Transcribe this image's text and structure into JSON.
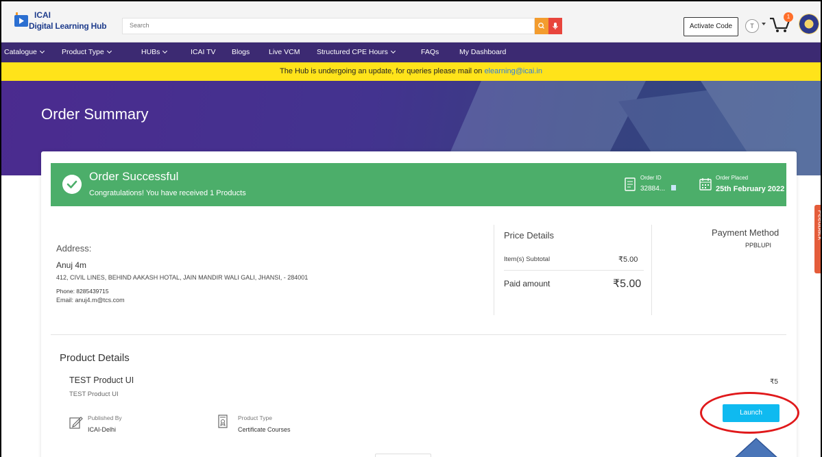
{
  "header": {
    "logo_line1": "ICAI",
    "logo_line2": "Digital Learning Hub",
    "search_placeholder": "Search",
    "activate_label": "Activate Code",
    "avatar_initial": "T",
    "cart_count": "1"
  },
  "nav": {
    "items": [
      {
        "label": "Catalogue",
        "dropdown": true
      },
      {
        "label": "Product Type",
        "dropdown": true
      },
      {
        "label": "HUBs",
        "dropdown": true
      },
      {
        "label": "ICAI TV",
        "dropdown": false
      },
      {
        "label": "Blogs",
        "dropdown": false
      },
      {
        "label": "Live VCM",
        "dropdown": false
      },
      {
        "label": "Structured CPE Hours",
        "dropdown": true
      },
      {
        "label": "FAQs",
        "dropdown": false
      },
      {
        "label": "My Dashboard",
        "dropdown": false
      }
    ]
  },
  "notice": {
    "text": "The Hub is undergoing an update, for queries please mail on ",
    "email": "elearning@icai.in"
  },
  "page": {
    "title": "Order Summary"
  },
  "order": {
    "status_title": "Order Successful",
    "status_sub": "Congratulations! You have received 1 Products",
    "order_id_label": "Order ID",
    "order_id_value": "32884...",
    "order_placed_label": "Order Placed",
    "order_placed_value": "25th February 2022"
  },
  "address": {
    "label": "Address:",
    "name": "Anuj 4m",
    "line": "412, CIVIL LINES, BEHIND AAKASH HOTAL, JAIN MANDIR WALI GALI, JHANSI, - 284001",
    "phone": "Phone: 8285439715",
    "email": "Email: anuj4.m@tcs.com"
  },
  "price": {
    "title": "Price Details",
    "subtotal_label": "Item(s) Subtotal",
    "subtotal_value": "₹5.00",
    "paid_label": "Paid amount",
    "paid_value": "₹5.00"
  },
  "payment": {
    "title": "Payment Method",
    "value": "PPBLUPI"
  },
  "product": {
    "section_title": "Product Details",
    "name": "TEST Product UI",
    "subtitle": "TEST Product UI",
    "price": "₹5",
    "published_label": "Published By",
    "published_value": "ICAI-Delhi",
    "type_label": "Product Type",
    "type_value": "Certificate Courses",
    "launch_label": "Launch"
  },
  "feedback_label": "Feedback",
  "colors": {
    "nav_bg": "#3c2a72",
    "notice_bg": "#ffe31a",
    "success_bg": "#4cae6a",
    "launch_bg": "#0fbaf0",
    "highlight_ring": "#e0191b"
  }
}
